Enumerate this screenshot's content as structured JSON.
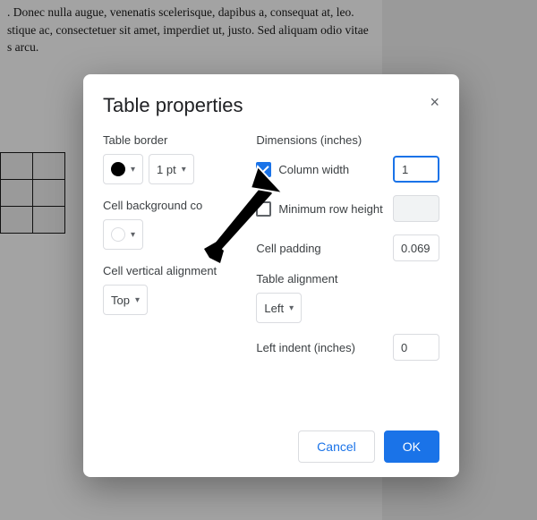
{
  "background": {
    "text_line1": ". Donec nulla augue, venenatis scelerisque, dapibus a, consequat at, leo.",
    "text_line2": "stique ac, consectetuer sit amet, imperdiet ut, justo. Sed aliquam odio vitae",
    "text_line3": "s arcu."
  },
  "dialog": {
    "title": "Table properties",
    "close_glyph": "×",
    "left": {
      "border_label": "Table border",
      "border_size": "1 pt",
      "bg_label": "Cell background co",
      "valign_label": "Cell vertical alignment",
      "valign_value": "Top"
    },
    "right": {
      "dimensions_label": "Dimensions (inches)",
      "col_width_label": "Column width",
      "col_width_value": "1",
      "row_height_label": "Minimum row height",
      "row_height_value": "",
      "cell_pad_label": "Cell padding",
      "cell_pad_value": "0.069",
      "table_align_label": "Table alignment",
      "table_align_value": "Left",
      "left_indent_label": "Left indent (inches)",
      "left_indent_value": "0"
    },
    "actions": {
      "cancel": "Cancel",
      "ok": "OK"
    }
  }
}
